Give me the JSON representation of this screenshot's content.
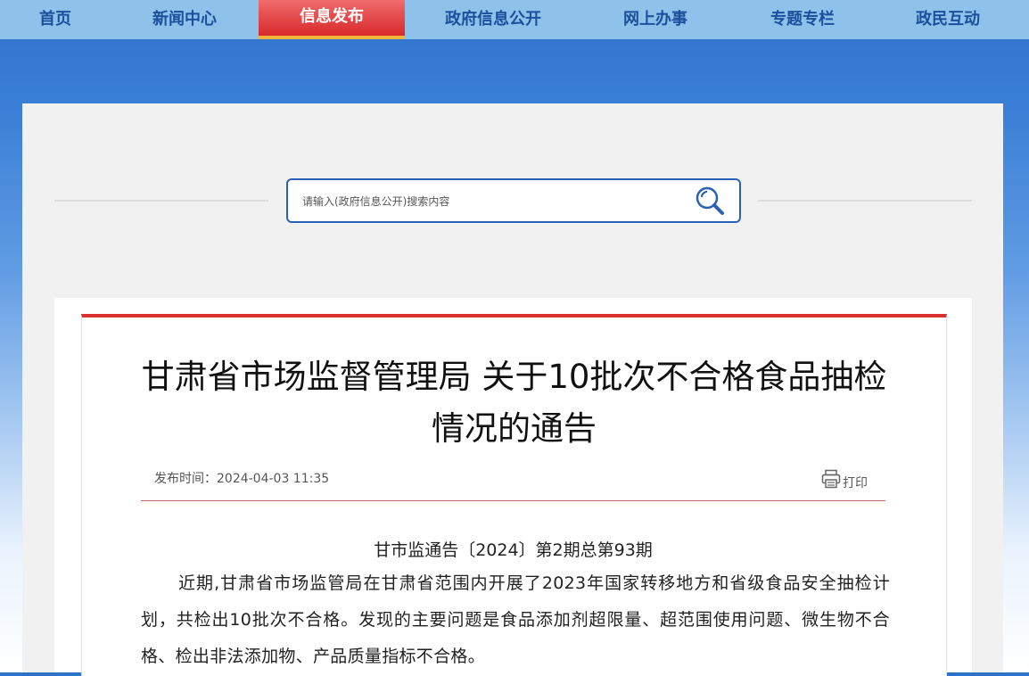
{
  "nav": {
    "items": [
      {
        "label": "首页"
      },
      {
        "label": "新闻中心"
      },
      {
        "label": "信息发布"
      },
      {
        "label": "政府信息公开"
      },
      {
        "label": "网上办事"
      },
      {
        "label": "专题专栏"
      },
      {
        "label": "政民互动"
      }
    ],
    "active_label": "信息发布"
  },
  "search": {
    "placeholder": "请输入(政府信息公开)搜索内容",
    "icon": "search-icon"
  },
  "article": {
    "title": "甘肃省市场监督管理局 关于10批次不合格食品抽检情况的通告",
    "publish_time": "发布时间：2024-04-03 11:35",
    "print_label": "打印",
    "print_icon": "printer-icon",
    "doc_number": "甘市监通告〔2024〕第2期总第93期",
    "paragraph": "近期,甘肃省市场监管局在甘肃省范围内开展了2023年国家转移地方和省级食品安全抽检计划，共检出10批次不合格。发现的主要问题是食品添加剂超限量、超范围使用问题、微生物不合格、检出非法添加物、产品质量指标不合格。"
  },
  "colors": {
    "nav_bg": "#8ec2ea",
    "nav_text": "#1c4f9c",
    "active_bg": "#d8292b",
    "active_underline": "#f3b43d",
    "article_top_border": "#d93030",
    "search_border": "#2962b4"
  }
}
